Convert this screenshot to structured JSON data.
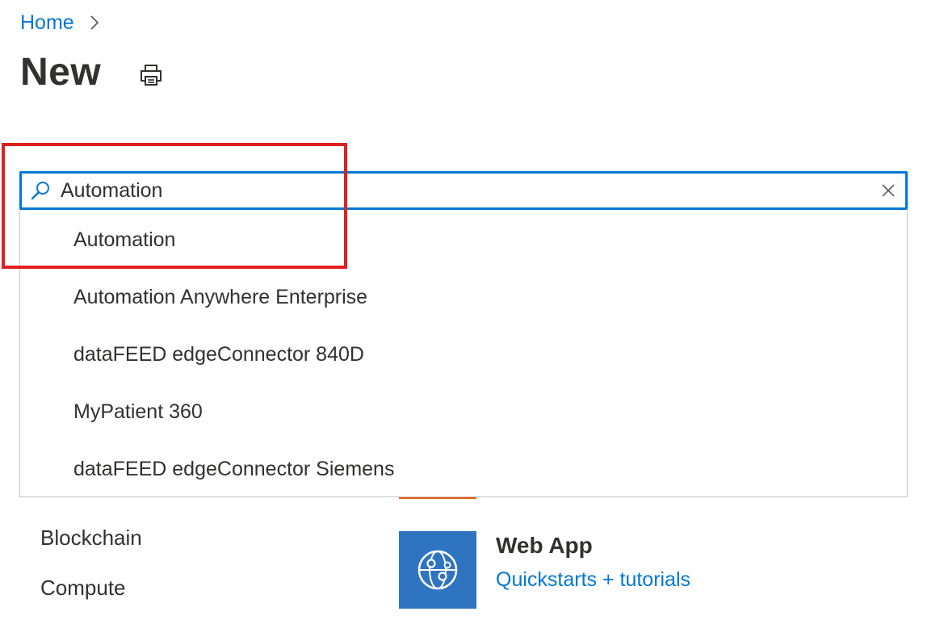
{
  "breadcrumb": {
    "home_label": "Home",
    "separator_icon": "chevron-right-icon"
  },
  "header": {
    "title": "New",
    "print_icon": "print-icon"
  },
  "search": {
    "value": "Automation",
    "placeholder": "",
    "search_icon": "search-icon",
    "clear_icon": "close-icon",
    "suggestions": [
      "Automation",
      "Automation Anywhere Enterprise",
      "dataFEED edgeConnector 840D",
      "MyPatient 360",
      "dataFEED edgeConnector Siemens"
    ]
  },
  "categories": [
    "Blockchain",
    "Compute"
  ],
  "featured": {
    "web_app": {
      "title": "Web App",
      "link": "Quickstarts + tutorials",
      "icon": "web-app-globe-icon"
    }
  },
  "colors": {
    "accent": "#0078d4",
    "highlight": "#e02020",
    "web_app_tile": "#2f74c0",
    "featured_tile_stub": "#e8590c"
  }
}
